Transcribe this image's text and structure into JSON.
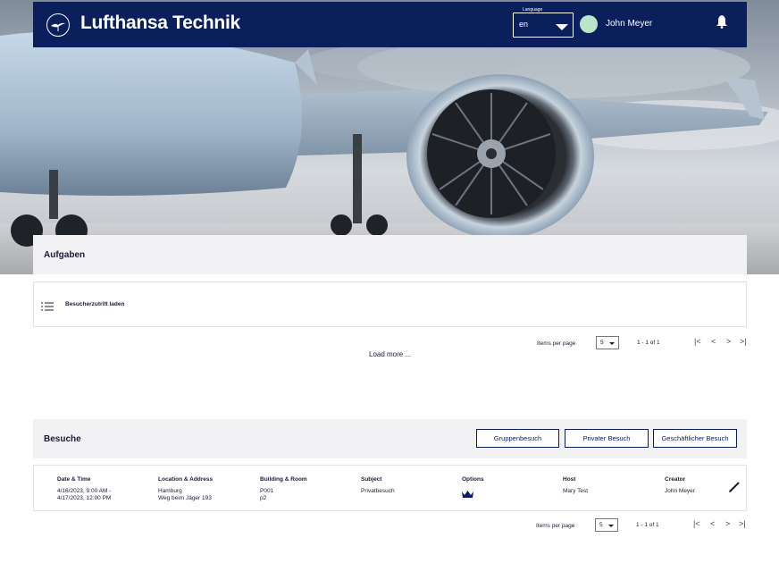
{
  "header": {
    "brand": "Lufthansa Technik",
    "language_legend": "Language",
    "language_value": "en",
    "user_name": "John Meyer"
  },
  "tasks": {
    "title": "Aufgaben",
    "items": [
      {
        "label": "Besucherzutritt laden"
      }
    ],
    "pagination": {
      "items_per_page_label": "Items per page",
      "items_per_page": "5",
      "range": "1 - 1 of 1"
    },
    "load_more": "Load more ..."
  },
  "visits": {
    "title": "Besuche",
    "buttons": {
      "group": "Gruppenbesuch",
      "private": "Privater Besuch",
      "business": "Geschäftlicher Besuch"
    },
    "columns": {
      "datetime": "Date & Time",
      "location": "Location & Address",
      "building": "Building & Room",
      "subject": "Subject",
      "options": "Options",
      "host": "Host",
      "creator": "Creator"
    },
    "rows": [
      {
        "datetime_1": "4/16/2023, 9:00 AM -",
        "datetime_2": "4/17/2023, 12:00 PM",
        "location_1": "Hamburg",
        "location_2": "Weg beim Jäger 193",
        "building_1": "P001",
        "building_2": "p2",
        "subject": "Privatbesuch",
        "options_icon": "crown-icon",
        "host": "Mary Test",
        "creator": "John Meyer"
      }
    ],
    "pagination": {
      "items_per_page_label": "Items per page",
      "items_per_page": "5",
      "range": "1 - 1 of 1"
    }
  },
  "colors": {
    "header_bg": "#0b1f5c",
    "section_bg": "#f2f2f4",
    "avatar": "#b9e6c8"
  }
}
